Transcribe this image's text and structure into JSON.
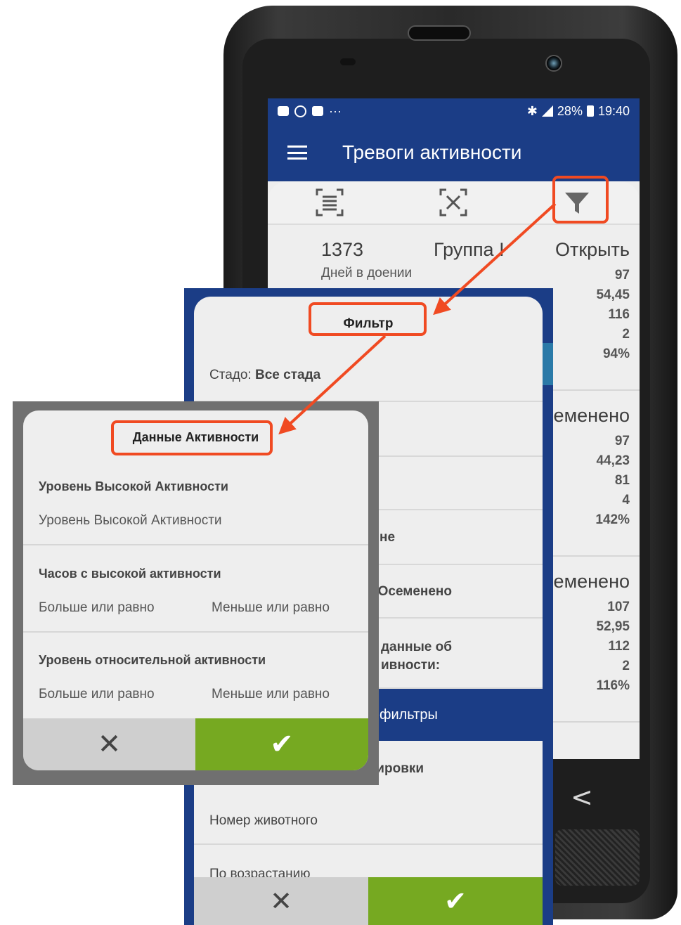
{
  "status_bar": {
    "battery": "28%",
    "time": "19:40",
    "more": "···",
    "bluetooth": "✱"
  },
  "app_bar": {
    "title": "Тревоги активности"
  },
  "toolbar": {
    "icons": [
      "select-all-icon",
      "deselect-icon",
      "filter-icon"
    ]
  },
  "cards": [
    {
      "id": "1373",
      "group": "Группа I",
      "status": "Открыть",
      "dim_label": "Дней в доении",
      "values": [
        "97",
        "54,45",
        "116",
        "2",
        "94%"
      ]
    },
    {
      "status": "еменено",
      "values": [
        "97",
        "44,23",
        "81",
        "4",
        "142%"
      ]
    },
    {
      "status": "еменено",
      "values": [
        "107",
        "52,95",
        "112",
        "2",
        "116%"
      ]
    }
  ],
  "filter_dialog": {
    "title": "Фильтр",
    "herd_label": "Стадо:",
    "herd_value": "Все стада",
    "row_partial_1": "не",
    "row_partial_2": ": Осеменено",
    "row_partial_3a": "данные об",
    "row_partial_3b": "ивности:",
    "banner": "фильтры",
    "sort_partial": "тировки",
    "sort_field": "Номер животного",
    "sort_order": "По возрастанию",
    "cancel": "✕",
    "ok": "✔"
  },
  "activity_dialog": {
    "title": "Данные Активности",
    "high_activity_level_title": "Уровень Высокой Активности",
    "high_activity_level_value": "Уровень Высокой Активности",
    "hours_high_title": "Часов с высокой активности",
    "hours_high_min": "Больше или равно",
    "hours_high_max": "Меньше или равно",
    "relative_title": "Уровень относительной активности",
    "relative_min": "Больше или равно",
    "relative_max": "Меньше или равно",
    "cancel": "✕",
    "ok": "✔"
  },
  "colors": {
    "primary": "#1b3d86",
    "accent_green": "#76a921",
    "highlight": "#f04a22"
  }
}
